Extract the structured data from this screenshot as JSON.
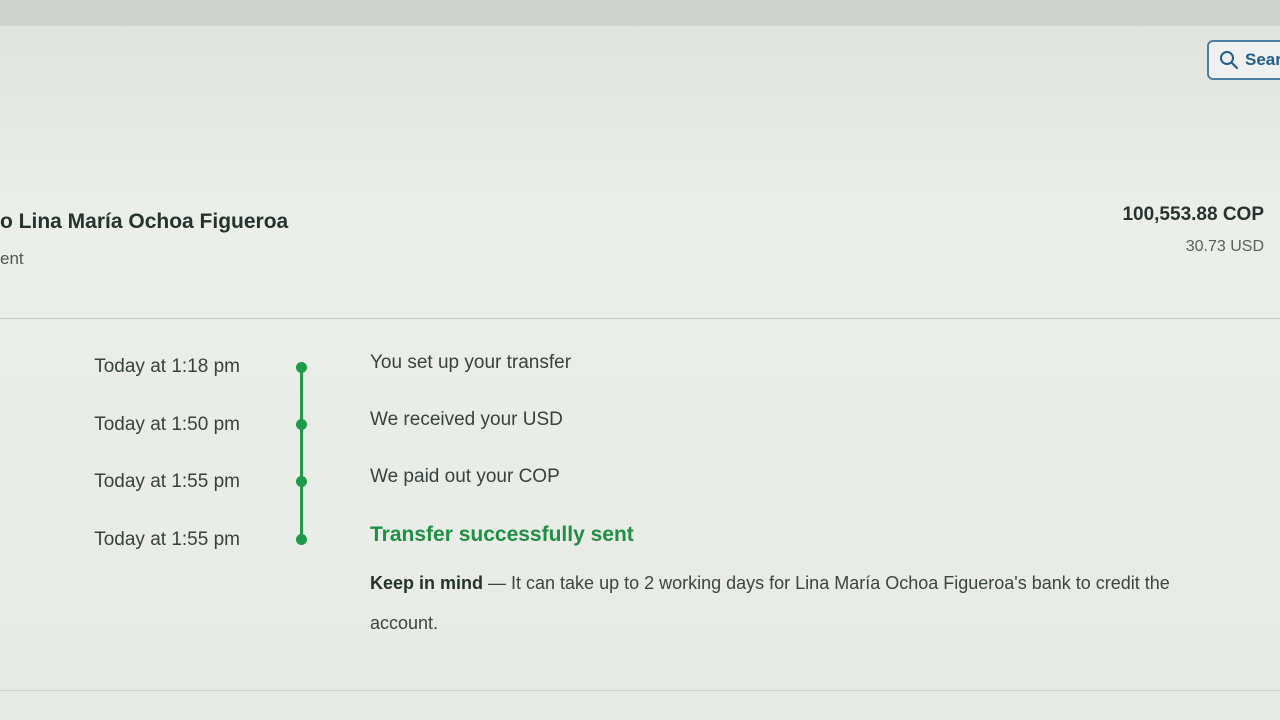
{
  "header": {
    "search_label": "Sear",
    "search_icon": "search-icon",
    "accent_color": "#255f8a"
  },
  "transfer": {
    "recipient_label": "o Lina María Ochoa Figueroa",
    "status_label": "ent",
    "amount_primary": "100,553.88 COP",
    "amount_secondary": "30.73 USD"
  },
  "timeline": {
    "color": "#1d9b49",
    "events": [
      {
        "time": "Today at 1:18 pm",
        "text": "You set up your transfer"
      },
      {
        "time": "Today at 1:50 pm",
        "text": "We received your USD"
      },
      {
        "time": "Today at 1:55 pm",
        "text": "We paid out your COP"
      },
      {
        "time": "Today at 1:55 pm",
        "text": "Transfer successfully sent"
      }
    ]
  },
  "note": {
    "label": "Keep in mind",
    "text": " — It can take up to 2 working days for Lina María Ochoa Figueroa's bank to credit the account."
  }
}
